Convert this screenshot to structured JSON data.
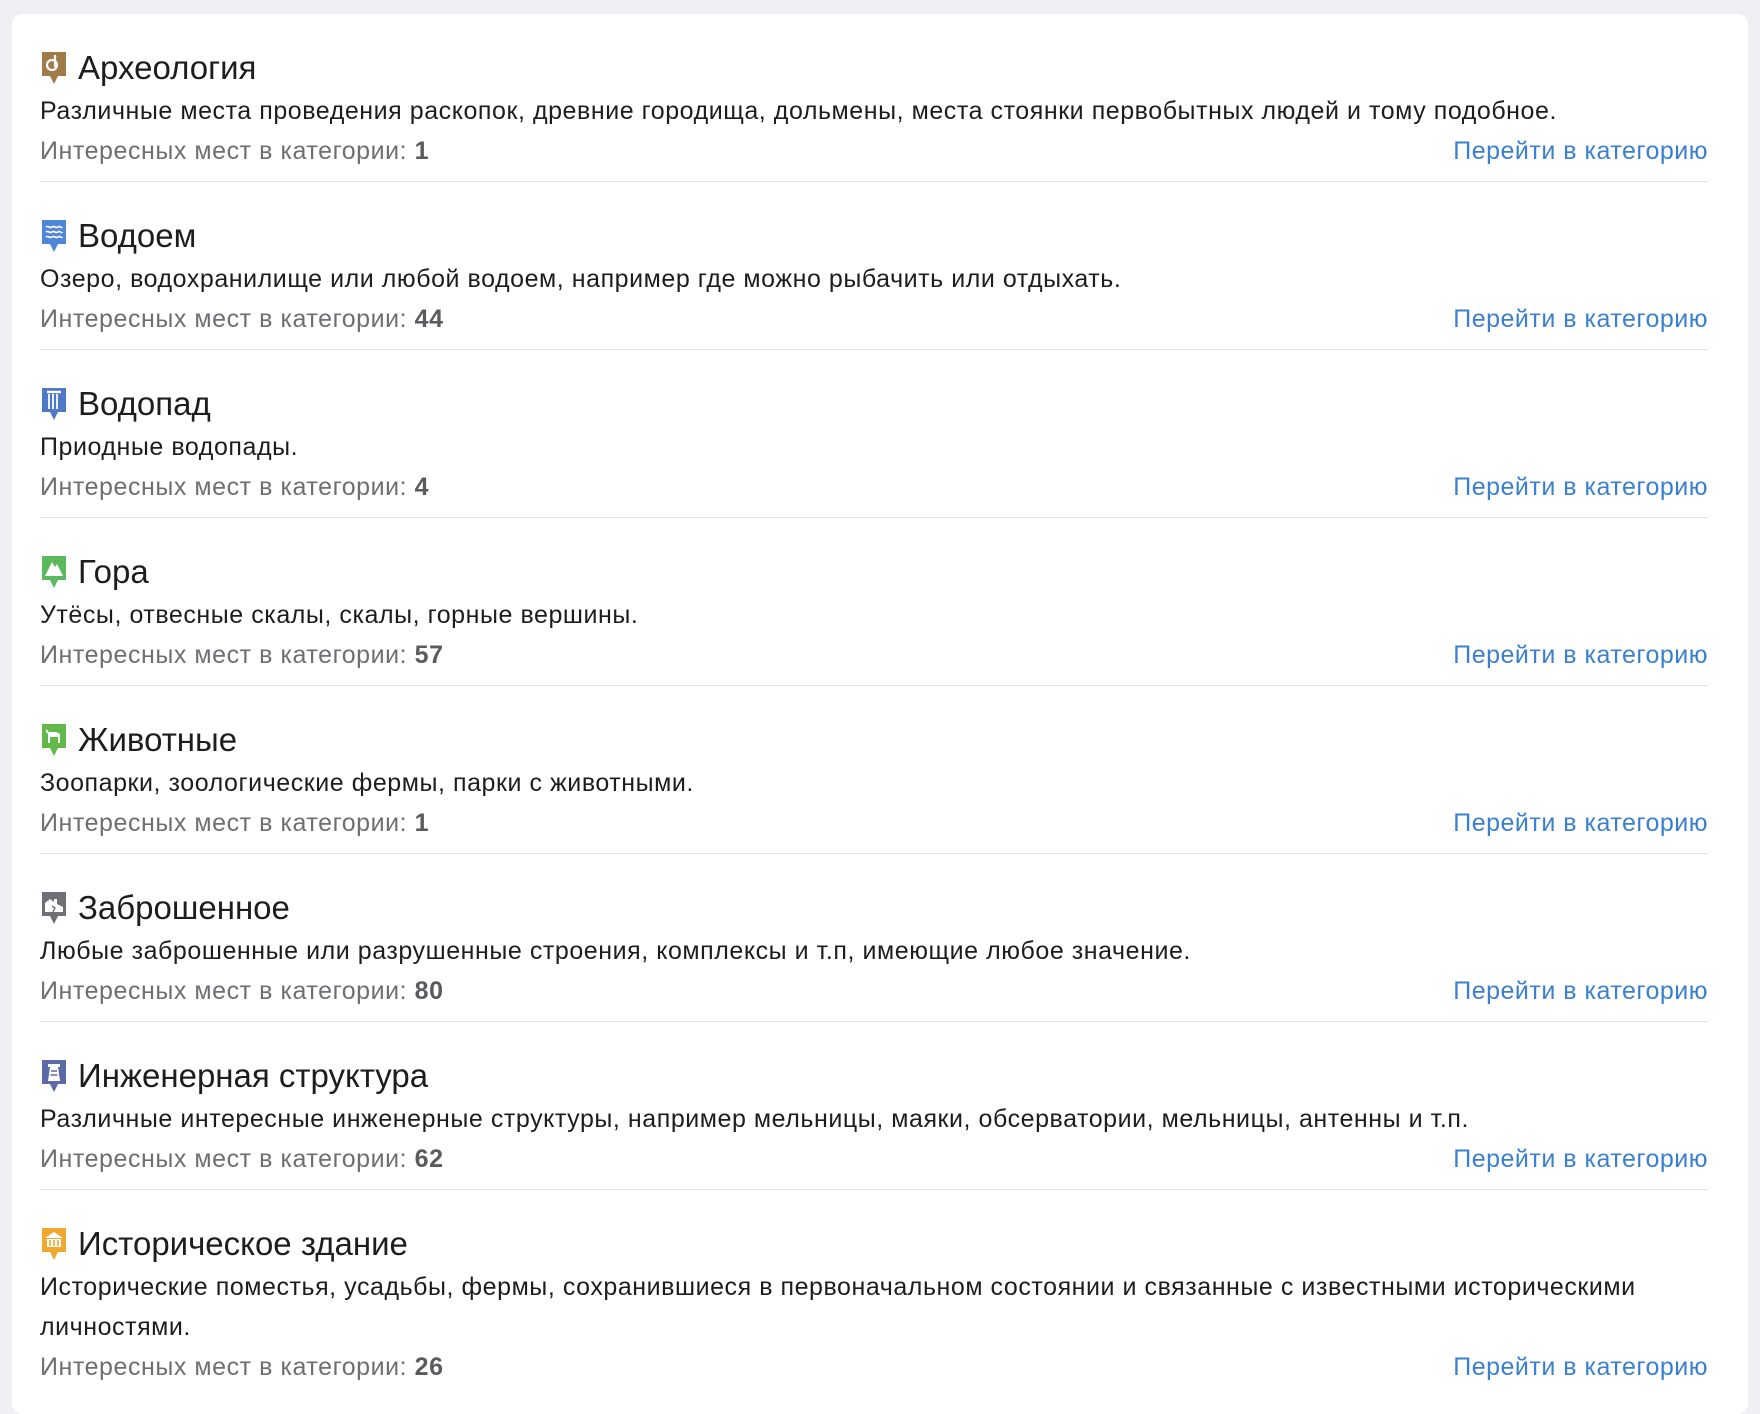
{
  "stats_label": "Интересных мест в категории:",
  "link_label": "Перейти в категорию",
  "categories": [
    {
      "icon": "archaeology-icon",
      "color": "#a07a48",
      "title": "Археология",
      "description": "Различные места проведения раскопок, древние городища, дольмены, места стоянки первобытных людей и тому подобное.",
      "count": "1"
    },
    {
      "icon": "water-body-icon",
      "color": "#4f86d8",
      "title": "Водоем",
      "description": "Озеро, водохранилище или любой водоем, например где можно рыбачить или отдыхать.",
      "count": "44"
    },
    {
      "icon": "waterfall-icon",
      "color": "#4f78c8",
      "title": "Водопад",
      "description": "Приодные водопады.",
      "count": "4"
    },
    {
      "icon": "mountain-icon",
      "color": "#5cb85c",
      "title": "Гора",
      "description": "Утёсы, отвесные скалы, скалы, горные вершины.",
      "count": "57"
    },
    {
      "icon": "animals-icon",
      "color": "#62b84a",
      "title": "Животные",
      "description": "Зоопарки, зоологические фермы, парки с животными.",
      "count": "1"
    },
    {
      "icon": "abandoned-icon",
      "color": "#6f6f78",
      "title": "Заброшенное",
      "description": "Любые заброшенные или разрушенные строения, комплексы и т.п, имеющие любое значение.",
      "count": "80"
    },
    {
      "icon": "engineering-structure-icon",
      "color": "#5c6aa8",
      "title": "Инженерная структура",
      "description": "Различные интересные инженерные структуры, например мельницы, маяки, обсерватории, мельницы, антенны и т.п.",
      "count": "62"
    },
    {
      "icon": "historic-building-icon",
      "color": "#f0a830",
      "title": "Историческое здание",
      "description": "Исторические поместья, усадьбы, фермы, сохранившиеся в первоначальном состоянии и связанные с известными историческими личностями.",
      "count": "26"
    }
  ]
}
